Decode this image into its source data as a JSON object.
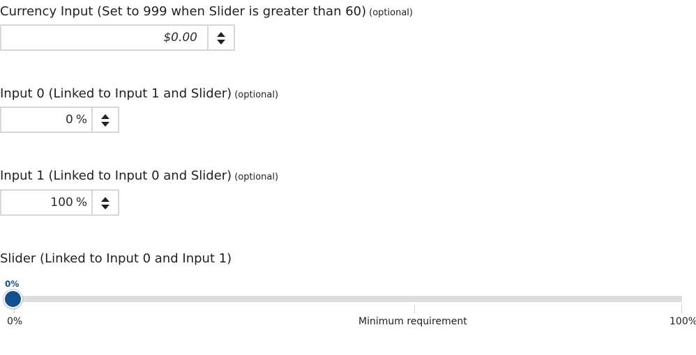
{
  "currency_input": {
    "label": "Currency Input (Set to 999 when Slider is greater than 60)",
    "optional": "(optional)",
    "value": "$0.00"
  },
  "input0": {
    "label": "Input 0 (Linked to Input 1 and Slider)",
    "optional": "(optional)",
    "value": "0",
    "unit": "%"
  },
  "input1": {
    "label": "Input 1 (Linked to Input 0 and Slider)",
    "optional": "(optional)",
    "value": "100",
    "unit": "%"
  },
  "slider": {
    "label": "Slider (Linked to Input 0 and Input 1)",
    "value_percent": 0,
    "value_label": "0%",
    "min_label": "0%",
    "mid_label": "Minimum requirement",
    "max_label": "100%",
    "accent_color": "#12508f",
    "track_color": "#dedede"
  },
  "icons": {
    "spinner_up": "caret-up-icon",
    "spinner_down": "caret-down-icon"
  }
}
